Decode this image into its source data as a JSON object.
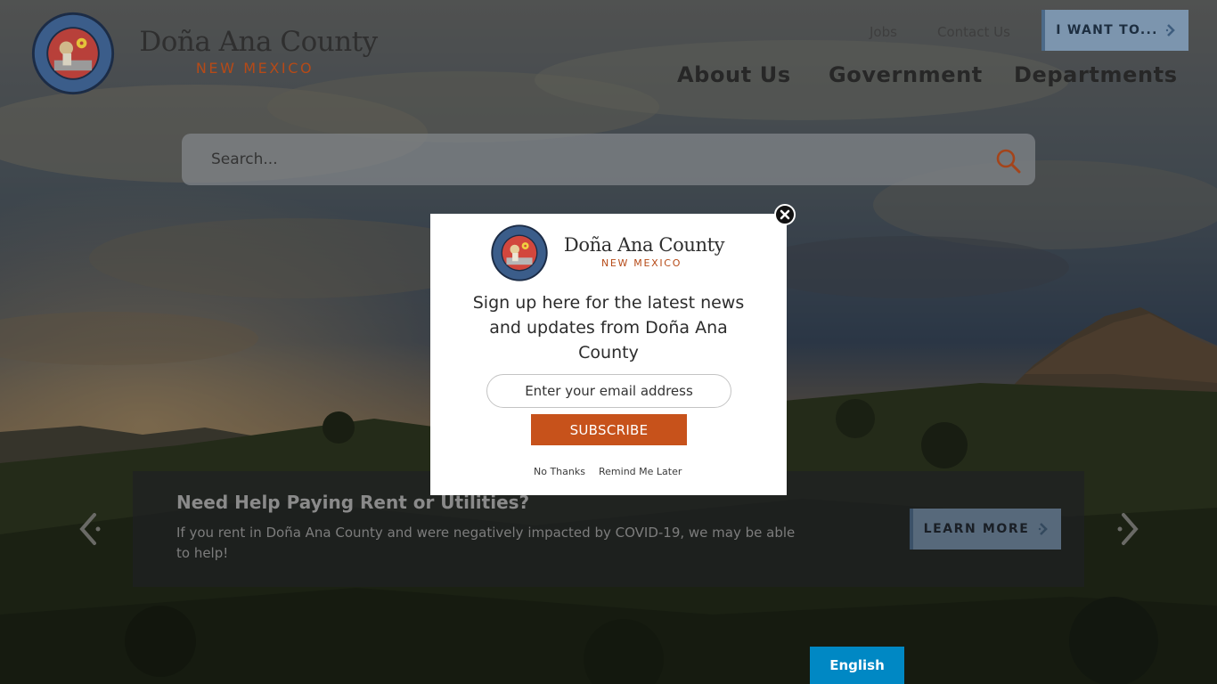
{
  "site": {
    "name": "Doña Ana County",
    "state": "NEW MEXICO"
  },
  "utility_nav": {
    "jobs": "Jobs",
    "contact": "Contact Us",
    "want_to": "I WANT TO..."
  },
  "main_nav": [
    "About Us",
    "Government",
    "Departments"
  ],
  "search": {
    "placeholder": "Search..."
  },
  "banner": {
    "title": "Need Help Paying Rent or Utilities?",
    "text": "If you rent in Doña Ana County and were negatively impacted by COVID-19, we may be able to help!",
    "button": "LEARN MORE"
  },
  "language": {
    "selected": "English"
  },
  "modal": {
    "brand_name": "Doña Ana County",
    "brand_state": "NEW MEXICO",
    "message": "Sign up here for the latest news and updates from Doña Ana County",
    "email_placeholder": "Enter your email address",
    "subscribe": "SUBSCRIBE",
    "no_thanks": "No Thanks",
    "remind_later": "Remind Me Later"
  },
  "colors": {
    "accent_orange": "#c7521b",
    "state_text": "#b64a17",
    "button_blue": "#7c95ae",
    "language_blue": "#0088c4"
  },
  "icons": [
    "county-seal-icon",
    "search-icon",
    "chevron-right-icon",
    "arrow-left-icon",
    "arrow-right-icon",
    "close-icon"
  ]
}
